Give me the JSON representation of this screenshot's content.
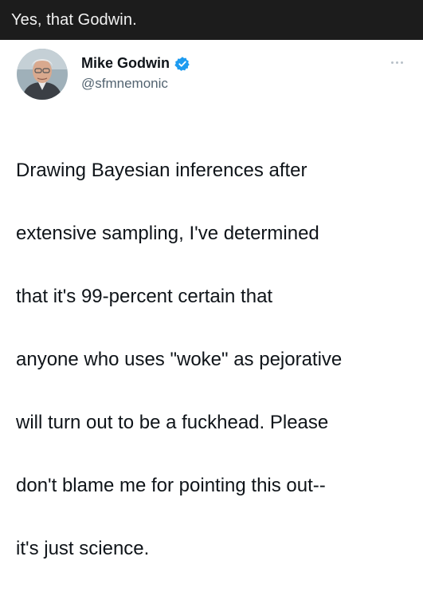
{
  "caption": {
    "text": "Yes, that Godwin."
  },
  "tweet": {
    "display_name": "Mike Godwin",
    "handle": "@sfmnemonic",
    "verified_icon": "verified-badge-icon",
    "more_icon": "more-options-icon",
    "text_lines": [
      "Drawing Bayesian inferences after",
      "extensive sampling, I've determined",
      "that it's 99-percent certain that",
      "anyone who uses \"woke\" as pejorative",
      "will turn out to be a fuckhead. Please",
      "don't blame me for pointing this out--",
      "it's just science."
    ]
  },
  "colors": {
    "caption_bg": "#1c1c1c",
    "verified_blue": "#1d9bf0",
    "handle_gray": "#536471"
  }
}
